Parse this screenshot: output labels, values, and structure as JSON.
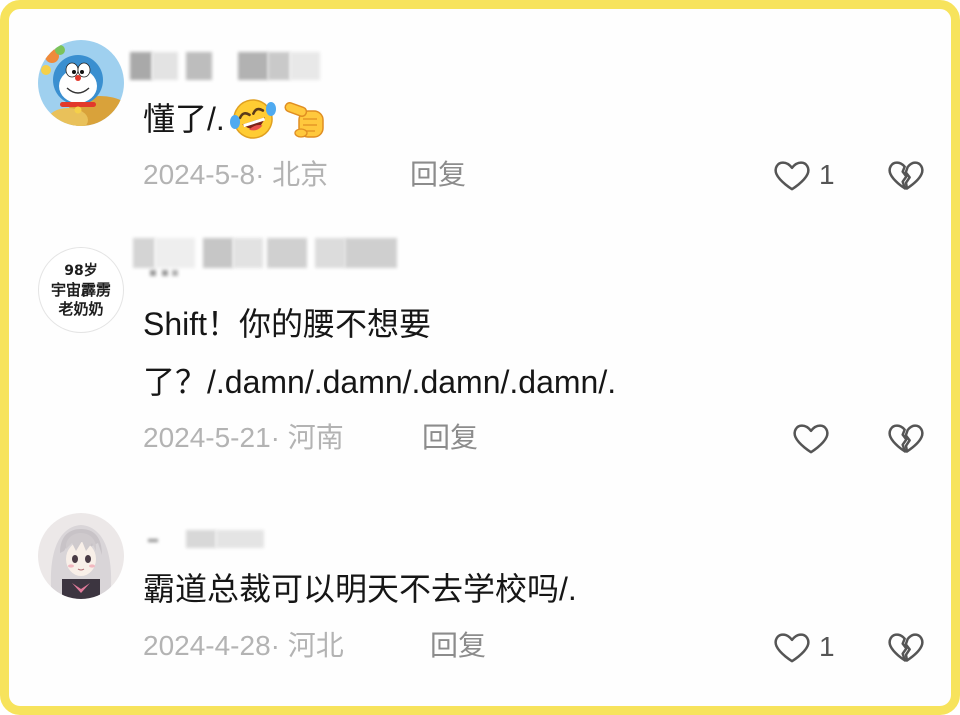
{
  "comments": [
    {
      "text_lines": [
        "懂了/."
      ],
      "emojis": [
        "laughing-crying-emoji",
        "pointing-hand-emoji"
      ],
      "date_location": "2024-5-8· 北京",
      "reply_label": "回复",
      "likes": "1"
    },
    {
      "avatar_text": [
        "98岁",
        "宇宙霹雳",
        "老奶奶"
      ],
      "text_lines": [
        "Shift！你的腰不想要",
        "了？/.damn/.damn/.damn/.damn/."
      ],
      "date_location": "2024-5-21· 河南",
      "reply_label": "回复"
    },
    {
      "text_lines": [
        "霸道总裁可以明天不去学校吗/."
      ],
      "date_location": "2024-4-28· 河北",
      "reply_label": "回复",
      "likes": "1"
    }
  ],
  "icons": {
    "like": "heart-outline-icon",
    "dislike": "broken-heart-icon",
    "username": "blurred-username"
  },
  "colors": {
    "frame_border": "#F7E35C",
    "comment_text": "#161616",
    "meta_text": "#B3B3B3",
    "reply_text": "#8C8C8C",
    "icon_stroke": "#555555"
  }
}
